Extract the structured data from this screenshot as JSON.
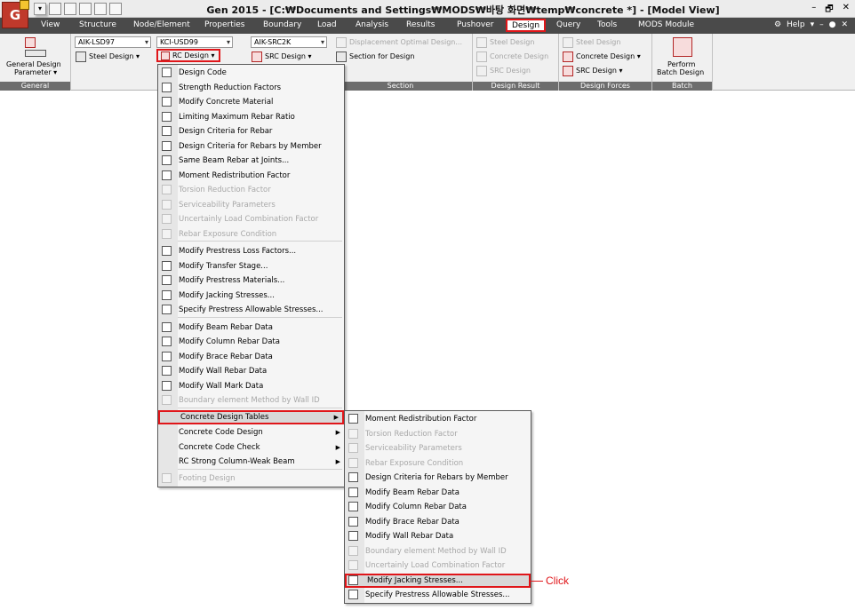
{
  "titlebar": {
    "app_logo": "G",
    "title": "Gen 2015 - [C:₩Documents and Settings₩MODS₩바탕 화면₩temp₩concrete *] - [Model View]",
    "quick_access_menu": "▾",
    "window_controls": {
      "minimize": "–",
      "restore": "🗗",
      "close": "✕"
    }
  },
  "menubar": {
    "tabs": [
      "View",
      "Structure",
      "Node/Element",
      "Properties",
      "Boundary",
      "Load",
      "Analysis",
      "Results",
      "Pushover",
      "Design",
      "Query",
      "Tools",
      "MODS Module"
    ],
    "active_tab": "Design",
    "help": "Help",
    "help_arrow": "▾",
    "icons": {
      "help": "⚙",
      "minimize": "–",
      "settings": "●",
      "close": "✕"
    }
  },
  "ribbon": {
    "general": {
      "button": "General Design",
      "button2": "Parameter ▾",
      "label": "General"
    },
    "combos": {
      "steel_code": "AIK-LSD97",
      "rc_code": "KCI-USD99",
      "src_code": "AIK-SRC2K"
    },
    "steel_design": "Steel Design ▾",
    "rc_design": "RC Design ▾",
    "src_design": "SRC Design ▾",
    "section": {
      "item1": "Displacement Optimal Design...",
      "item2": "Section for Design",
      "label": "Section"
    },
    "design_result": {
      "item1": "Steel Design",
      "item2": "Concrete Design",
      "item3": "SRC Design",
      "label": "Design Result"
    },
    "design_forces": {
      "item1": "Steel Design",
      "item2": "Concrete Design ▾",
      "item3": "SRC Design ▾",
      "label": "Design Forces"
    },
    "batch": {
      "button": "Perform",
      "button2": "Batch Design",
      "label": "Batch"
    }
  },
  "rc_menu": {
    "items": [
      {
        "label": "Design Code",
        "enabled": true
      },
      {
        "label": "Strength Reduction Factors",
        "enabled": true
      },
      {
        "label": "Modify Concrete Material",
        "enabled": true
      },
      {
        "label": "Limiting Maximum Rebar Ratio",
        "enabled": true
      },
      {
        "label": "Design Criteria for Rebar",
        "enabled": true
      },
      {
        "label": "Design Criteria for Rebars by Member",
        "enabled": true
      },
      {
        "label": "Same Beam Rebar at Joints...",
        "enabled": true
      },
      {
        "label": "Moment Redistribution Factor",
        "enabled": true
      },
      {
        "label": "Torsion Reduction Factor",
        "enabled": false
      },
      {
        "label": "Serviceability Parameters",
        "enabled": false
      },
      {
        "label": "Uncertainly Load Combination Factor",
        "enabled": false
      },
      {
        "label": "Rebar Exposure Condition",
        "enabled": false
      },
      {
        "label": "Modify Prestress Loss Factors...",
        "enabled": true
      },
      {
        "label": "Modify Transfer Stage...",
        "enabled": true
      },
      {
        "label": "Modify Prestress Materials...",
        "enabled": true
      },
      {
        "label": "Modify Jacking Stresses...",
        "enabled": true
      },
      {
        "label": "Specify Prestress Allowable Stresses...",
        "enabled": true
      },
      {
        "label": "Modify Beam Rebar Data",
        "enabled": true
      },
      {
        "label": "Modify Column Rebar Data",
        "enabled": true
      },
      {
        "label": "Modify Brace Rebar Data",
        "enabled": true
      },
      {
        "label": "Modify Wall Rebar Data",
        "enabled": true
      },
      {
        "label": "Modify Wall Mark Data",
        "enabled": true
      },
      {
        "label": "Boundary element Method by Wall ID",
        "enabled": false
      },
      {
        "label": "Concrete Design Tables",
        "enabled": true,
        "submenu": true,
        "highlighted": true
      },
      {
        "label": "Concrete Code Design",
        "enabled": true,
        "submenu": true
      },
      {
        "label": "Concrete Code Check",
        "enabled": true,
        "submenu": true
      },
      {
        "label": "RC Strong Column-Weak Beam",
        "enabled": true,
        "submenu": true
      },
      {
        "label": "Footing Design",
        "enabled": false
      }
    ]
  },
  "sub_menu": {
    "items": [
      {
        "label": "Moment Redistribution Factor",
        "enabled": true
      },
      {
        "label": "Torsion Reduction Factor",
        "enabled": false
      },
      {
        "label": "Serviceability Parameters",
        "enabled": false
      },
      {
        "label": "Rebar Exposure Condition",
        "enabled": false
      },
      {
        "label": "Design Criteria for Rebars by Member",
        "enabled": true
      },
      {
        "label": "Modify Beam Rebar Data",
        "enabled": true
      },
      {
        "label": "Modify Column Rebar Data",
        "enabled": true
      },
      {
        "label": "Modify Brace Rebar Data",
        "enabled": true
      },
      {
        "label": "Modify Wall Rebar Data",
        "enabled": true
      },
      {
        "label": "Boundary element Method by Wall ID",
        "enabled": false
      },
      {
        "label": "Uncertainly Load Combination Factor",
        "enabled": false
      },
      {
        "label": "Modify Jacking Stresses...",
        "enabled": true,
        "highlighted": true
      },
      {
        "label": "Specify Prestress Allowable Stresses...",
        "enabled": true
      }
    ]
  },
  "annotation": {
    "click": "Click"
  },
  "colors": {
    "highlight": "#e0161a",
    "menubar": "#4a4a4a",
    "ribbon": "#f0f0f0"
  }
}
